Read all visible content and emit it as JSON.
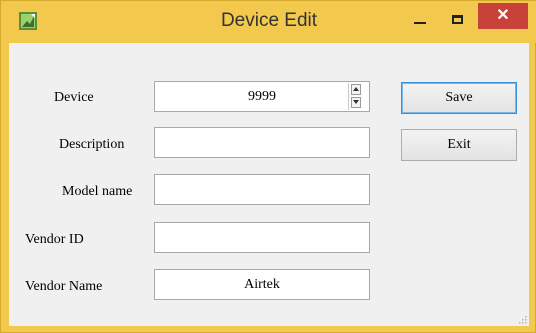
{
  "window": {
    "title": "Device Edit"
  },
  "titlebar": {
    "app_icon": "app-icon",
    "minimize_icon": "minimize-icon",
    "maximize_icon": "maximize-icon",
    "close_glyph": "✕"
  },
  "form": {
    "device_label": "Device",
    "device_value": "9999",
    "description_label": "Description",
    "description_value": "",
    "model_label": "Model name",
    "model_value": "",
    "vendor_id_label": "Vendor ID",
    "vendor_id_value": "",
    "vendor_name_label": "Vendor Name",
    "vendor_name_value": "Airtek"
  },
  "buttons": {
    "save_label": "Save",
    "exit_label": "Exit"
  },
  "colors": {
    "titlebar": "#f2c94c",
    "close": "#c8423a",
    "client": "#f0f0f0"
  }
}
